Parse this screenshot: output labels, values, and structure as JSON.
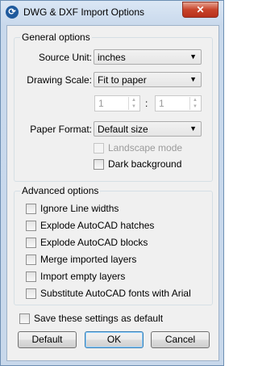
{
  "window": {
    "title": "DWG & DXF Import Options",
    "close_label": "✕"
  },
  "general": {
    "title": "General options",
    "source_unit_label": "Source Unit:",
    "source_unit_value": "inches",
    "drawing_scale_label": "Drawing Scale:",
    "drawing_scale_value": "Fit to paper",
    "scale_left": "1",
    "scale_right": "1",
    "scale_sep": ":",
    "paper_format_label": "Paper Format:",
    "paper_format_value": "Default size",
    "landscape_label": "Landscape mode",
    "dark_bg_label": "Dark background"
  },
  "advanced": {
    "title": "Advanced options",
    "items": [
      "Ignore Line widths",
      "Explode AutoCAD hatches",
      "Explode AutoCAD blocks",
      "Merge imported layers",
      "Import empty layers",
      "Substitute AutoCAD fonts with Arial"
    ]
  },
  "save_default_label": "Save these settings as default",
  "buttons": {
    "default": "Default",
    "ok": "OK",
    "cancel": "Cancel"
  }
}
